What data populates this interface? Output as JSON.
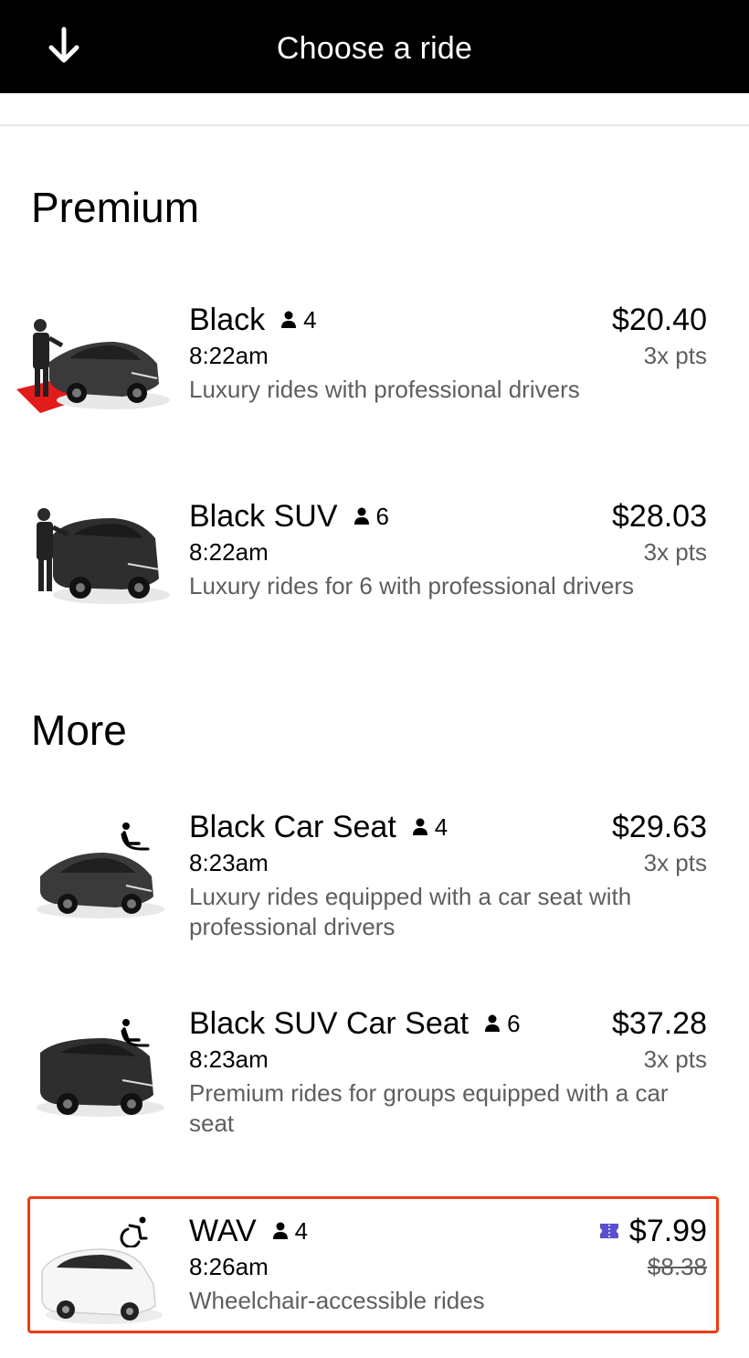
{
  "header": {
    "title": "Choose a ride",
    "back_icon": "arrow-down-icon"
  },
  "sections": {
    "premium": "Premium",
    "more": "More"
  },
  "rides": [
    {
      "name": "Black",
      "capacity": "4",
      "time": "8:22am",
      "description": "Luxury rides with professional drivers",
      "price": "$20.40",
      "points": "3x pts"
    },
    {
      "name": "Black SUV",
      "capacity": "6",
      "time": "8:22am",
      "description": "Luxury rides for 6 with professional drivers",
      "price": "$28.03",
      "points": "3x pts"
    },
    {
      "name": "Black Car Seat",
      "capacity": "4",
      "time": "8:23am",
      "description": "Luxury rides equipped with a car seat with professional drivers",
      "price": "$29.63",
      "points": "3x pts"
    },
    {
      "name": "Black SUV Car Seat",
      "capacity": "6",
      "time": "8:23am",
      "description": "Premium rides for groups equipped with a car seat",
      "price": "$37.28",
      "points": "3x pts"
    },
    {
      "name": "WAV",
      "capacity": "4",
      "time": "8:26am",
      "description": "Wheelchair-accessible rides",
      "price": "$7.99",
      "original_price": "$8.38",
      "selected": true
    }
  ],
  "colors": {
    "selection_border": "#f03c12",
    "promo_icon": "#5a4fcf",
    "header_bg": "#000000"
  }
}
